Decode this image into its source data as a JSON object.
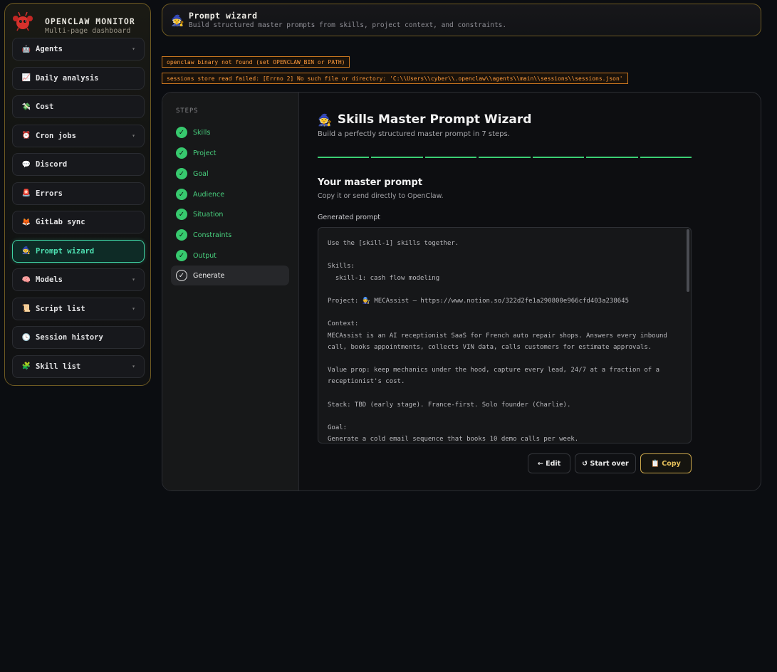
{
  "brand": {
    "title": "OPENCLAW MONITOR",
    "subtitle": "Multi-page dashboard"
  },
  "nav": [
    {
      "icon": "🤖",
      "label": "Agents",
      "caret": "▾"
    },
    {
      "icon": "📈",
      "label": "Daily analysis",
      "caret": ""
    },
    {
      "icon": "💸",
      "label": "Cost",
      "caret": ""
    },
    {
      "icon": "⏰",
      "label": "Cron jobs",
      "caret": "▾"
    },
    {
      "icon": "💬",
      "label": "Discord",
      "caret": ""
    },
    {
      "icon": "🚨",
      "label": "Errors",
      "caret": ""
    },
    {
      "icon": "🦊",
      "label": "GitLab sync",
      "caret": ""
    },
    {
      "icon": "🧙",
      "label": "Prompt wizard",
      "caret": "",
      "active": true
    },
    {
      "icon": "🧠",
      "label": "Models",
      "caret": "▾"
    },
    {
      "icon": "📜",
      "label": "Script list",
      "caret": "▾"
    },
    {
      "icon": "🕓",
      "label": "Session history",
      "caret": ""
    },
    {
      "icon": "🧩",
      "label": "Skill list",
      "caret": "▾"
    }
  ],
  "header": {
    "icon": "🧙",
    "title": "Prompt wizard",
    "subtitle": "Build structured master prompts from skills, project context, and constraints."
  },
  "alerts": [
    "openclaw binary not found (set OPENCLAW_BIN or PATH)",
    "sessions store read failed: [Errno 2] No such file or directory: 'C:\\\\Users\\\\cyber\\\\.openclaw\\\\agents\\\\main\\\\sessions\\\\sessions.json'"
  ],
  "steps": {
    "title": "STEPS",
    "items": [
      {
        "label": "Skills",
        "state": "done"
      },
      {
        "label": "Project",
        "state": "done"
      },
      {
        "label": "Goal",
        "state": "done"
      },
      {
        "label": "Audience",
        "state": "done"
      },
      {
        "label": "Situation",
        "state": "done"
      },
      {
        "label": "Constraints",
        "state": "done"
      },
      {
        "label": "Output",
        "state": "done"
      },
      {
        "label": "Generate",
        "state": "current"
      }
    ]
  },
  "wizard": {
    "icon": "🧙",
    "title": "Skills Master Prompt Wizard",
    "subtitle": "Build a perfectly structured master prompt in 7 steps.",
    "progress_done": 7,
    "progress_total": 7,
    "section_title": "Your master prompt",
    "section_subtitle": "Copy it or send directly to OpenClaw.",
    "generated_label": "Generated prompt",
    "prompt_text": "Use the [skill-1] skills together.\n\nSkills:\n  skill-1: cash flow modeling\n\nProject: 🧑‍🔧 MECAssist — https://www.notion.so/322d2fe1a290800e966cfd403a238645\n\nContext:\nMECAssist is an AI receptionist SaaS for French auto repair shops. Answers every inbound call, books appointments, collects VIN data, calls customers for estimate approvals.\n\nValue prop: keep mechanics under the hood, capture every lead, 24/7 at a fraction of a receptionist's cost.\n\nStack: TBD (early stage). France-first. Solo founder (Charlie).\n\nGoal:\nGenerate a cold email sequence that books 10 demo calls per week.",
    "buttons": {
      "edit": "← Edit",
      "start_over": "↺ Start over",
      "copy": "📋 Copy"
    }
  }
}
